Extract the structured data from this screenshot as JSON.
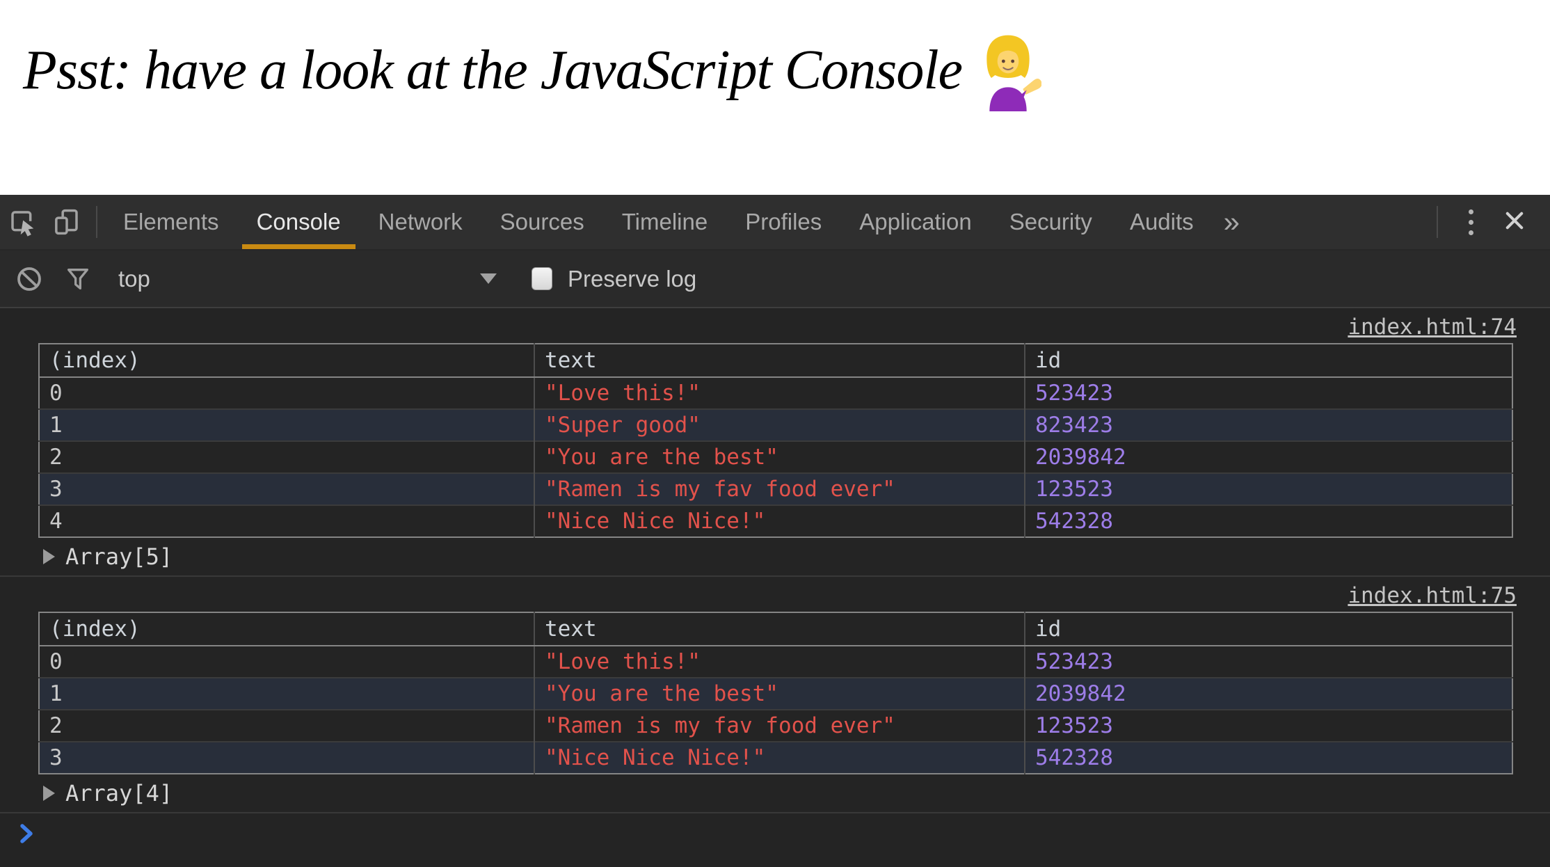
{
  "heading": {
    "text": "Psst: have a look at the JavaScript Console",
    "emoji": "person-tipping-hand"
  },
  "devtools": {
    "tabbar": {
      "tabs": [
        {
          "label": "Elements",
          "active": false
        },
        {
          "label": "Console",
          "active": true
        },
        {
          "label": "Network",
          "active": false
        },
        {
          "label": "Sources",
          "active": false
        },
        {
          "label": "Timeline",
          "active": false
        },
        {
          "label": "Profiles",
          "active": false
        },
        {
          "label": "Application",
          "active": false
        },
        {
          "label": "Security",
          "active": false
        },
        {
          "label": "Audits",
          "active": false
        }
      ],
      "more_tabs_chevron": "»"
    },
    "toolbar": {
      "frame_selector_value": "top",
      "preserve_log_label": "Preserve log",
      "preserve_log_checked": false
    },
    "console": {
      "messages": [
        {
          "source_link": "index.html:74",
          "table": {
            "columns": [
              "(index)",
              "text",
              "id"
            ],
            "rows": [
              {
                "index": "0",
                "text": "\"Love this!\"",
                "id": "523423"
              },
              {
                "index": "1",
                "text": "\"Super good\"",
                "id": "823423"
              },
              {
                "index": "2",
                "text": "\"You are the best\"",
                "id": "2039842"
              },
              {
                "index": "3",
                "text": "\"Ramen is my fav food ever\"",
                "id": "123523"
              },
              {
                "index": "4",
                "text": "\"Nice Nice Nice!\"",
                "id": "542328"
              }
            ]
          },
          "summary": "Array[5]"
        },
        {
          "source_link": "index.html:75",
          "table": {
            "columns": [
              "(index)",
              "text",
              "id"
            ],
            "rows": [
              {
                "index": "0",
                "text": "\"Love this!\"",
                "id": "523423"
              },
              {
                "index": "1",
                "text": "\"You are the best\"",
                "id": "2039842"
              },
              {
                "index": "2",
                "text": "\"Ramen is my fav food ever\"",
                "id": "123523"
              },
              {
                "index": "3",
                "text": "\"Nice Nice Nice!\"",
                "id": "542328"
              }
            ]
          },
          "summary": "Array[4]"
        }
      ]
    },
    "colors": {
      "tab_underline_accent": "#c98a12",
      "string_red": "#e2524b",
      "number_purple": "#9d7de8",
      "link_gray": "#c4c4c4",
      "prompt_blue": "#3e7de8",
      "alt_row_navy": "#282e3a"
    }
  }
}
